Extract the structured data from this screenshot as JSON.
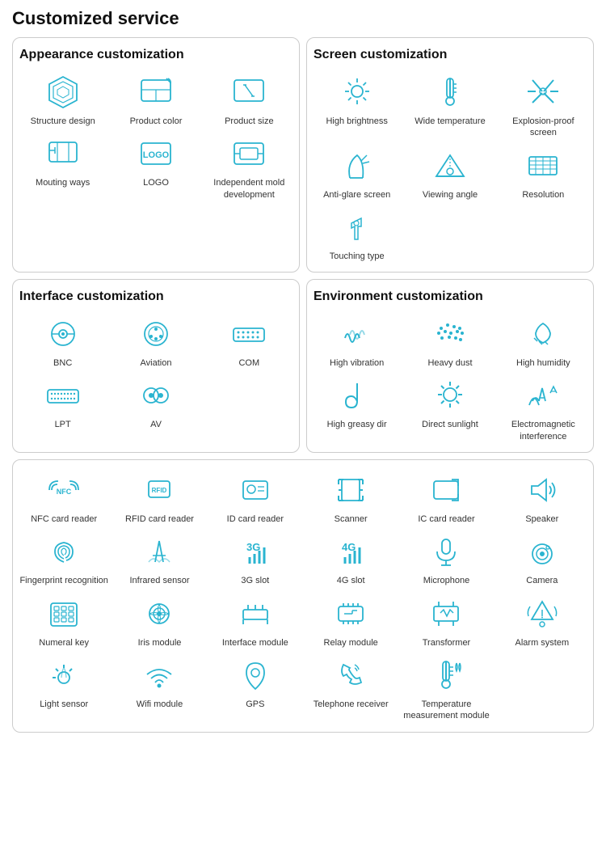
{
  "page": {
    "title": "Customized service"
  },
  "appearance": {
    "title": "Appearance customization",
    "items": [
      {
        "label": "Structure design"
      },
      {
        "label": "Product color"
      },
      {
        "label": "Product size"
      },
      {
        "label": "Mouting ways"
      },
      {
        "label": "LOGO"
      },
      {
        "label": "Independent mold development"
      }
    ]
  },
  "screen": {
    "title": "Screen customization",
    "items": [
      {
        "label": "High brightness"
      },
      {
        "label": "Wide temperature"
      },
      {
        "label": "Explosion-proof screen"
      },
      {
        "label": "Anti-glare screen"
      },
      {
        "label": "Viewing angle"
      },
      {
        "label": "Resolution"
      },
      {
        "label": "Touching type"
      }
    ]
  },
  "interface": {
    "title": "Interface customization",
    "items": [
      {
        "label": "BNC"
      },
      {
        "label": "Aviation"
      },
      {
        "label": "COM"
      },
      {
        "label": "LPT"
      },
      {
        "label": "AV"
      }
    ]
  },
  "environment": {
    "title": "Environment customization",
    "items": [
      {
        "label": "High vibration"
      },
      {
        "label": "Heavy dust"
      },
      {
        "label": "High humidity"
      },
      {
        "label": "High greasy dir"
      },
      {
        "label": "Direct sunlight"
      },
      {
        "label": "Electromagnetic interference"
      }
    ]
  },
  "peripherals": {
    "items": [
      {
        "label": "NFC card reader"
      },
      {
        "label": "RFID card reader"
      },
      {
        "label": "ID card reader"
      },
      {
        "label": "Scanner"
      },
      {
        "label": "IC card reader"
      },
      {
        "label": "Speaker"
      },
      {
        "label": "Fingerprint recognition"
      },
      {
        "label": "Infrared sensor"
      },
      {
        "label": "3G slot"
      },
      {
        "label": "4G slot"
      },
      {
        "label": "Microphone"
      },
      {
        "label": "Camera"
      },
      {
        "label": "Numeral key"
      },
      {
        "label": "Iris module"
      },
      {
        "label": "Interface module"
      },
      {
        "label": "Relay module"
      },
      {
        "label": "Transformer"
      },
      {
        "label": "Alarm system"
      },
      {
        "label": "Light sensor"
      },
      {
        "label": "Wifi module"
      },
      {
        "label": "GPS"
      },
      {
        "label": "Telephone receiver"
      },
      {
        "label": "Temperature measurement module"
      }
    ]
  }
}
